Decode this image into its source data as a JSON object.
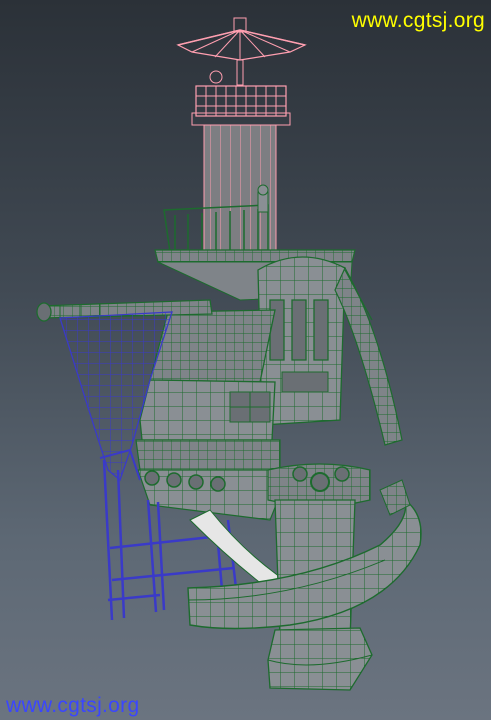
{
  "viewport": {
    "subject": "",
    "background_top": "#2b3138",
    "background_bottom": "#6b7480"
  },
  "colors": {
    "selected_wire": "#ff9fb0",
    "green_wire": "#1d6b2e",
    "blue_wire": "#3a3ac8",
    "mesh_fill": "#8a8f94",
    "mesh_dark": "#5c6166",
    "watermark_top": "#ffff00",
    "watermark_bottom": "#3a46ff"
  },
  "watermarks": {
    "top": "www.cgtsj.org",
    "bottom": "www.cgtsj.org"
  }
}
